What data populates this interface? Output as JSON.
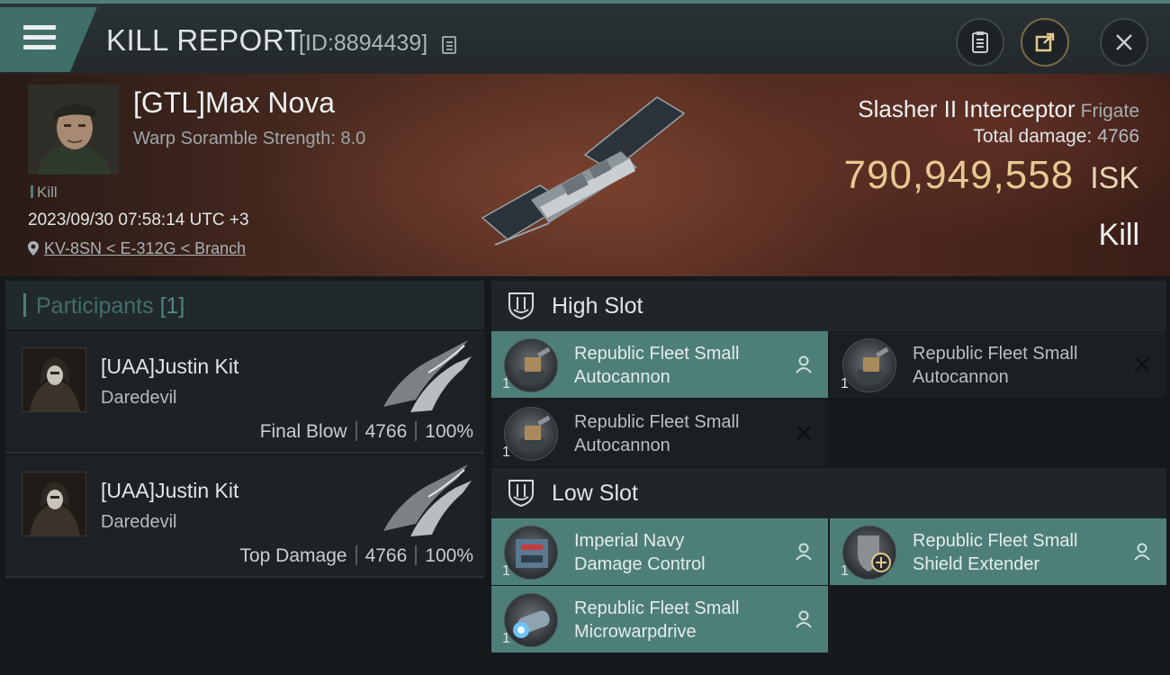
{
  "header": {
    "title": "KILL REPORT",
    "report_id": "[ID:8894439]",
    "buttons": [
      "clipboard-icon",
      "share-icon",
      "close-icon"
    ]
  },
  "victim": {
    "name": "[GTL]Max Nova",
    "scramble": "Warp Soramble Strength: 8.0",
    "kill_tag": "Kill",
    "datetime": "2023/09/30 07:58:14 UTC +3",
    "location": "KV-8SN < E-312G < Branch",
    "ship_name": "Slasher II Interceptor",
    "ship_class": "Frigate",
    "total_damage_label": "Total damage:",
    "total_damage": "4766",
    "isk_value": "790,949,558",
    "isk_unit": "ISK",
    "result": "Kill"
  },
  "participants": {
    "label": "Participants",
    "count": "[1]",
    "rows": [
      {
        "name": "[UAA]Justin Kit",
        "ship": "Daredevil",
        "tag": "Final Blow",
        "damage": "4766",
        "percent": "100%"
      },
      {
        "name": "[UAA]Justin Kit",
        "ship": "Daredevil",
        "tag": "Top Damage",
        "damage": "4766",
        "percent": "100%"
      }
    ]
  },
  "fitting": {
    "high_slot": {
      "label": "High Slot",
      "items": [
        {
          "name": "Republic Fleet Small\nAutocannon",
          "qty": "1",
          "status": "person-icon"
        },
        {
          "name": "Republic Fleet Small\nAutocannon",
          "qty": "1",
          "status": "close-icon"
        },
        {
          "name": "Republic Fleet Small\nAutocannon",
          "qty": "1",
          "status": "close-icon"
        }
      ]
    },
    "low_slot": {
      "label": "Low Slot",
      "items": [
        {
          "name": "Imperial Navy\nDamage Control",
          "qty": "1",
          "status": "person-icon"
        },
        {
          "name": "Republic Fleet Small\nShield Extender",
          "qty": "1",
          "status": "person-icon"
        },
        {
          "name": "Republic Fleet Small\nMicrowarpdrive",
          "qty": "1",
          "status": "person-icon"
        }
      ]
    }
  },
  "colors": {
    "accent": "#4d7f78",
    "isk": "#e8c891",
    "panel": "#1c2225"
  }
}
